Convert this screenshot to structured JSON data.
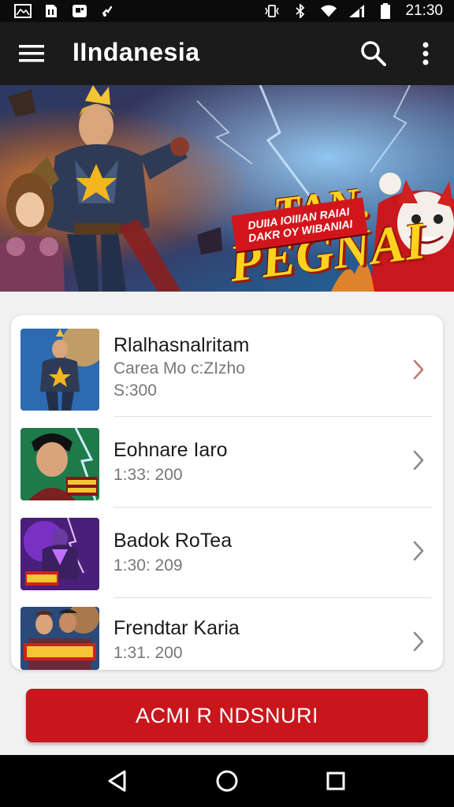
{
  "status_bar": {
    "time": "21:30",
    "left_icons": [
      "gallery-icon",
      "sim-icon",
      "app-icon",
      "notification-icon"
    ],
    "right_icons": [
      "vibrate-icon",
      "bluetooth-icon",
      "wifi-icon",
      "signal-icon",
      "battery-icon"
    ]
  },
  "app_bar": {
    "title": "IIndanesia",
    "menu_icon": "hamburger-menu-icon",
    "search_icon": "search-icon",
    "more_icon": "more-vert-icon"
  },
  "banner": {
    "title_line1": "TAN.",
    "title_line2": "PEGNAI",
    "ribbon_line1": "DUIIA IOIIIAN RAIAI",
    "ribbon_line2": "DAKR OY WIBANIAI"
  },
  "list": {
    "items": [
      {
        "name": "Rlalhasnalritam",
        "sub1": "Carea Mo c:ZIzho",
        "sub2": "S:300",
        "icon": "chevron-right-icon",
        "chevron_color": "#c0392b"
      },
      {
        "name": "Eohnare Iaro",
        "sub1": "1:33: 200",
        "icon": "chevron-right-icon",
        "chevron_color": "#888888"
      },
      {
        "name": "Badok RoTea",
        "sub1": "1:30: 209",
        "icon": "chevron-right-icon",
        "chevron_color": "#888888"
      },
      {
        "name": "Frendtar Karia",
        "sub1": "1:31. 200",
        "icon": "chevron-right-icon",
        "chevron_color": "#888888"
      }
    ]
  },
  "action_button": {
    "label": "ACMI R NDSNURI",
    "color": "#c8161c"
  },
  "nav_bar": {
    "back_icon": "back-triangle-icon",
    "home_icon": "home-circle-icon",
    "recents_icon": "recents-square-icon"
  },
  "colors": {
    "app_bar": "#1b1b1b",
    "accent_red": "#c8161c",
    "background": "#f1f1f1"
  }
}
